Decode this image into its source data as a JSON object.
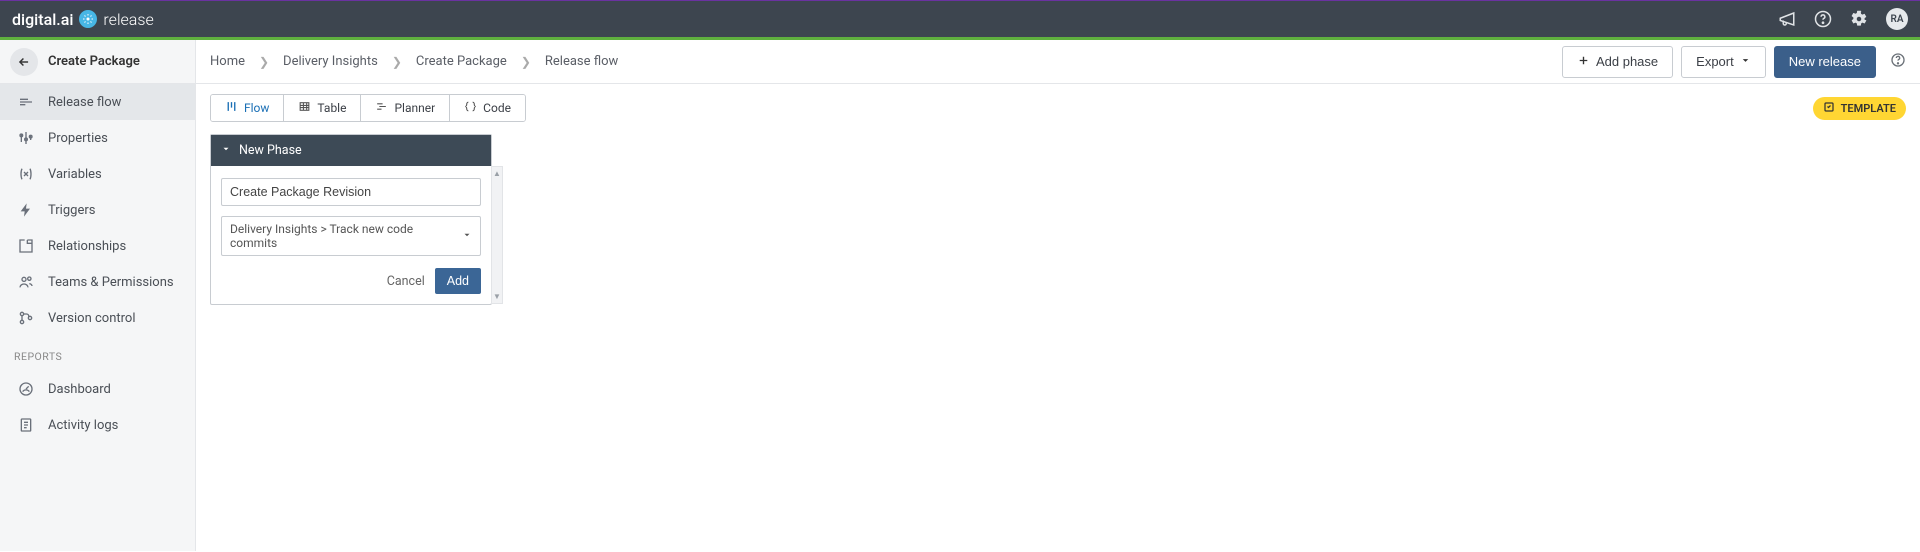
{
  "brand": {
    "name1": "digital.ai",
    "name2": "release"
  },
  "avatar": "RA",
  "sidebar": {
    "title": "Create Package",
    "items": [
      {
        "label": "Release flow"
      },
      {
        "label": "Properties"
      },
      {
        "label": "Variables"
      },
      {
        "label": "Triggers"
      },
      {
        "label": "Relationships"
      },
      {
        "label": "Teams & Permissions"
      },
      {
        "label": "Version control"
      }
    ],
    "reportsLabel": "REPORTS",
    "reports": [
      {
        "label": "Dashboard"
      },
      {
        "label": "Activity logs"
      }
    ]
  },
  "breadcrumb": {
    "home": "Home",
    "a": "Delivery Insights",
    "b": "Create Package",
    "c": "Release flow"
  },
  "actions": {
    "addPhase": "Add phase",
    "export": "Export",
    "newRelease": "New release"
  },
  "viewTabs": {
    "flow": "Flow",
    "table": "Table",
    "planner": "Planner",
    "code": "Code"
  },
  "badge": "TEMPLATE",
  "phase": {
    "header": "New Phase",
    "taskName": "Create Package Revision",
    "dropdown": "Delivery Insights > Track new code commits",
    "cancel": "Cancel",
    "add": "Add"
  }
}
